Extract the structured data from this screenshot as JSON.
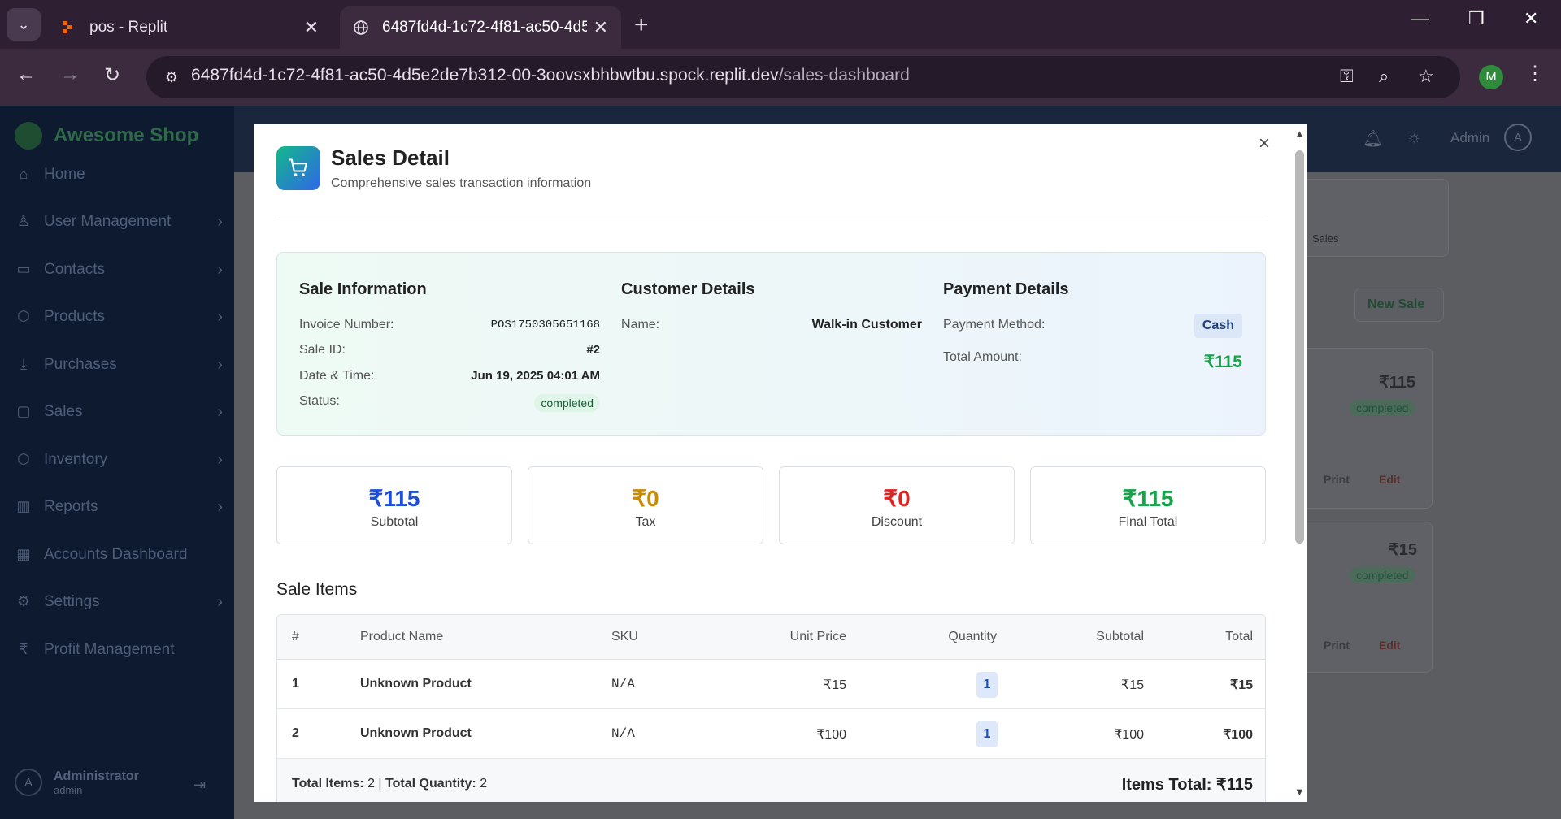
{
  "browser": {
    "tabs": [
      {
        "title": "pos - Replit",
        "active": false
      },
      {
        "title": "6487fd4d-1c72-4f81-ac50-4d5e",
        "active": true
      }
    ],
    "url_host": "6487fd4d-1c72-4f81-ac50-4d5e2de7b312-00-3oovsxbhbwtbu.spock.replit.dev",
    "url_path": "/sales-dashboard",
    "profile_initial": "M"
  },
  "app": {
    "name": "Awesome Shop",
    "sidebar": [
      {
        "label": "Home",
        "icon": "home-icon",
        "has_chevron": false
      },
      {
        "label": "User Management",
        "icon": "user-icon",
        "has_chevron": true
      },
      {
        "label": "Contacts",
        "icon": "contacts-icon",
        "has_chevron": true
      },
      {
        "label": "Products",
        "icon": "box-icon",
        "has_chevron": true
      },
      {
        "label": "Purchases",
        "icon": "download-icon",
        "has_chevron": true
      },
      {
        "label": "Sales",
        "icon": "bag-icon",
        "has_chevron": true
      },
      {
        "label": "Inventory",
        "icon": "box-icon",
        "has_chevron": true
      },
      {
        "label": "Reports",
        "icon": "chart-icon",
        "has_chevron": true
      },
      {
        "label": "Accounts Dashboard",
        "icon": "calculator-icon",
        "has_chevron": false
      },
      {
        "label": "Settings",
        "icon": "gear-icon",
        "has_chevron": true
      },
      {
        "label": "Profit Management",
        "icon": "rupee-icon",
        "has_chevron": false
      }
    ],
    "user": {
      "initial": "A",
      "name": "Administrator",
      "role": "admin"
    },
    "topbar": {
      "admin_label": "Admin",
      "admin_initial": "A"
    },
    "background": {
      "sales_label": "Sales",
      "new_sale_label": "New Sale",
      "cards": [
        {
          "amount": "₹115",
          "status": "completed",
          "print": "Print",
          "edit": "Edit"
        },
        {
          "amount": "₹15",
          "status": "completed",
          "print": "Print",
          "edit": "Edit"
        }
      ]
    }
  },
  "modal": {
    "title": "Sales Detail",
    "subtitle": "Comprehensive sales transaction information",
    "sale_info": {
      "heading": "Sale Information",
      "invoice_label": "Invoice Number:",
      "invoice_value": "POS1750305651168",
      "sale_id_label": "Sale ID:",
      "sale_id_value": "#2",
      "datetime_label": "Date & Time:",
      "datetime_value": "Jun 19, 2025 04:01 AM",
      "status_label": "Status:",
      "status_value": "completed"
    },
    "customer": {
      "heading": "Customer Details",
      "name_label": "Name:",
      "name_value": "Walk-in Customer"
    },
    "payment": {
      "heading": "Payment Details",
      "method_label": "Payment Method:",
      "method_value": "Cash",
      "total_label": "Total Amount:",
      "total_value": "₹115"
    },
    "stats": [
      {
        "value": "₹115",
        "label": "Subtotal",
        "color": "#1d4ed8"
      },
      {
        "value": "₹0",
        "label": "Tax",
        "color": "#ca8a04"
      },
      {
        "value": "₹0",
        "label": "Discount",
        "color": "#dc2626"
      },
      {
        "value": "₹115",
        "label": "Final Total",
        "color": "#16a34a"
      }
    ],
    "items_heading": "Sale Items",
    "columns": [
      "#",
      "Product Name",
      "SKU",
      "Unit Price",
      "Quantity",
      "Subtotal",
      "Total"
    ],
    "rows": [
      {
        "num": "1",
        "product": "Unknown Product",
        "sku": "N/A",
        "unit_price": "₹15",
        "quantity": "1",
        "subtotal": "₹15",
        "total": "₹15"
      },
      {
        "num": "2",
        "product": "Unknown Product",
        "sku": "N/A",
        "unit_price": "₹100",
        "quantity": "1",
        "subtotal": "₹100",
        "total": "₹100"
      }
    ],
    "footer": {
      "total_items_label": "Total Items:",
      "total_items_value": "2",
      "separator": "|",
      "total_qty_label": "Total Quantity:",
      "total_qty_value": "2",
      "items_total": "Items Total: ₹115"
    }
  }
}
